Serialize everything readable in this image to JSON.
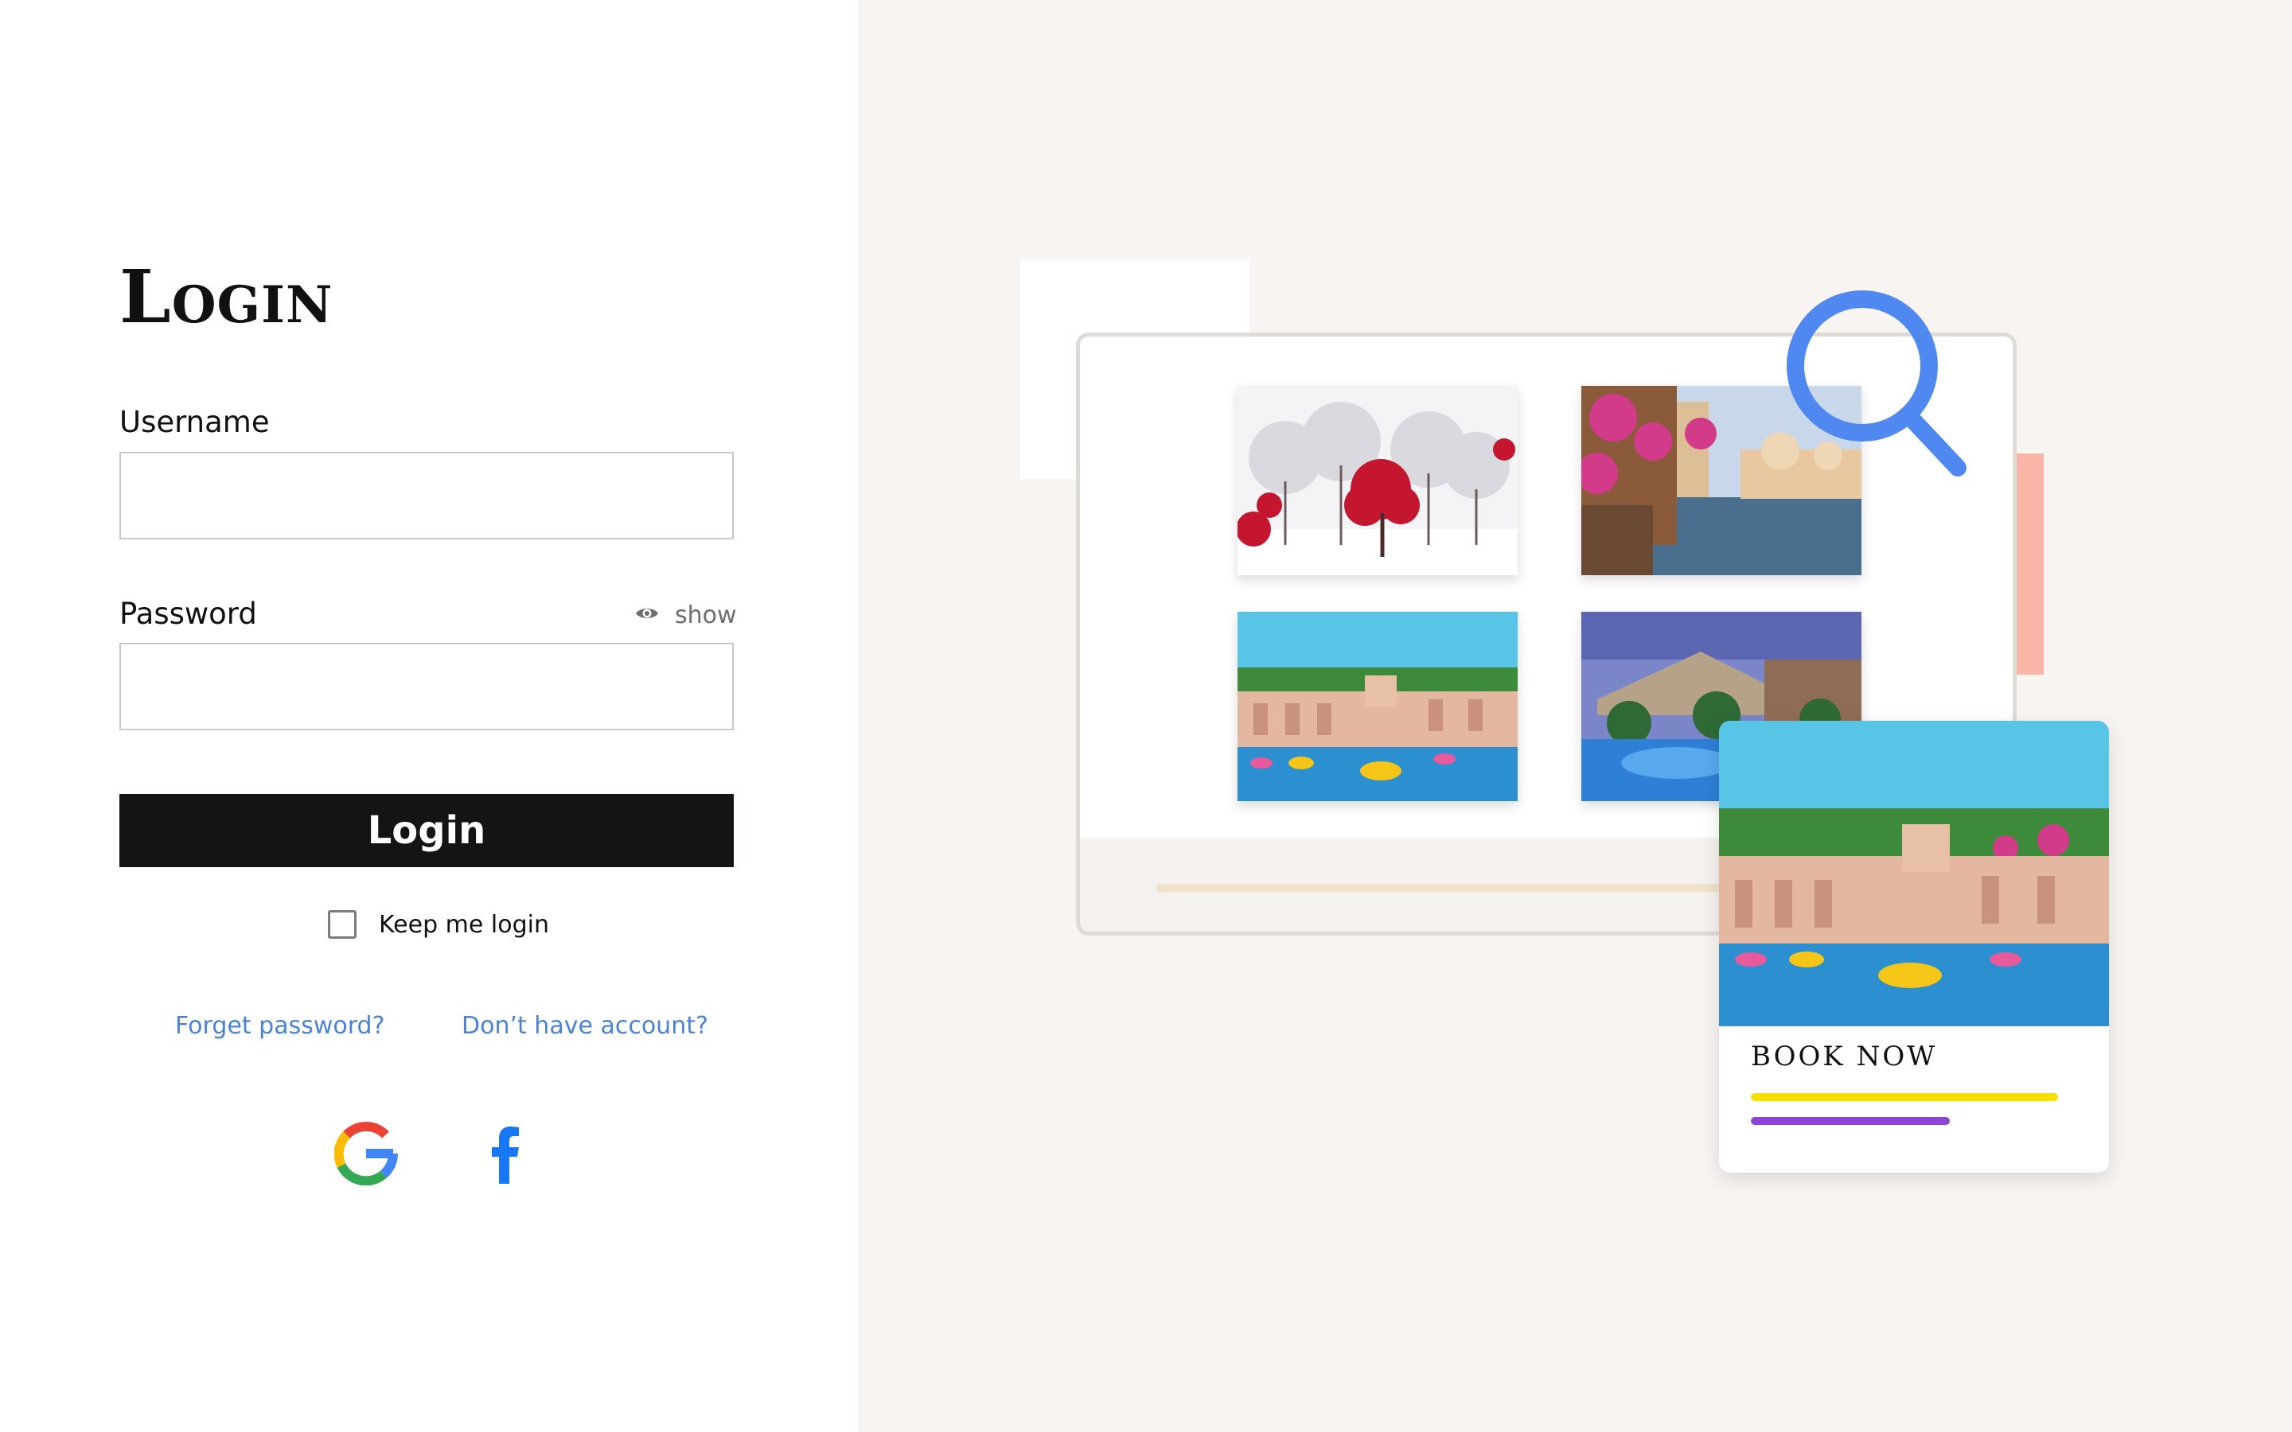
{
  "login_form": {
    "title": "Login",
    "username_label": "Username",
    "username_value": "",
    "password_label": "Password",
    "password_value": "",
    "show_label": "show",
    "submit_label": "Login",
    "keep_login_label": "Keep me login",
    "keep_login_checked": false,
    "forget_password_link": "Forget password?",
    "no_account_link": "Don’t have account?",
    "social_logins": [
      "google-icon",
      "facebook-icon"
    ]
  },
  "illustration": {
    "gallery_images": [
      "snowy-trees-image",
      "palace-pool-image",
      "garden-pool-image",
      "resort-pool-image"
    ],
    "search_icon": "search-icon",
    "book_card": {
      "image": "garden-pool-image",
      "title": "BOOK NOW"
    },
    "colors": {
      "panel_background": "#f7f4f1",
      "accent_blue": "#4f88f0",
      "accent_pink": "#f9b6a8",
      "accent_yellow": "#f4e102",
      "accent_purple": "#8d43d8",
      "link_blue": "#4a83d6",
      "button_dark": "#131515"
    }
  }
}
